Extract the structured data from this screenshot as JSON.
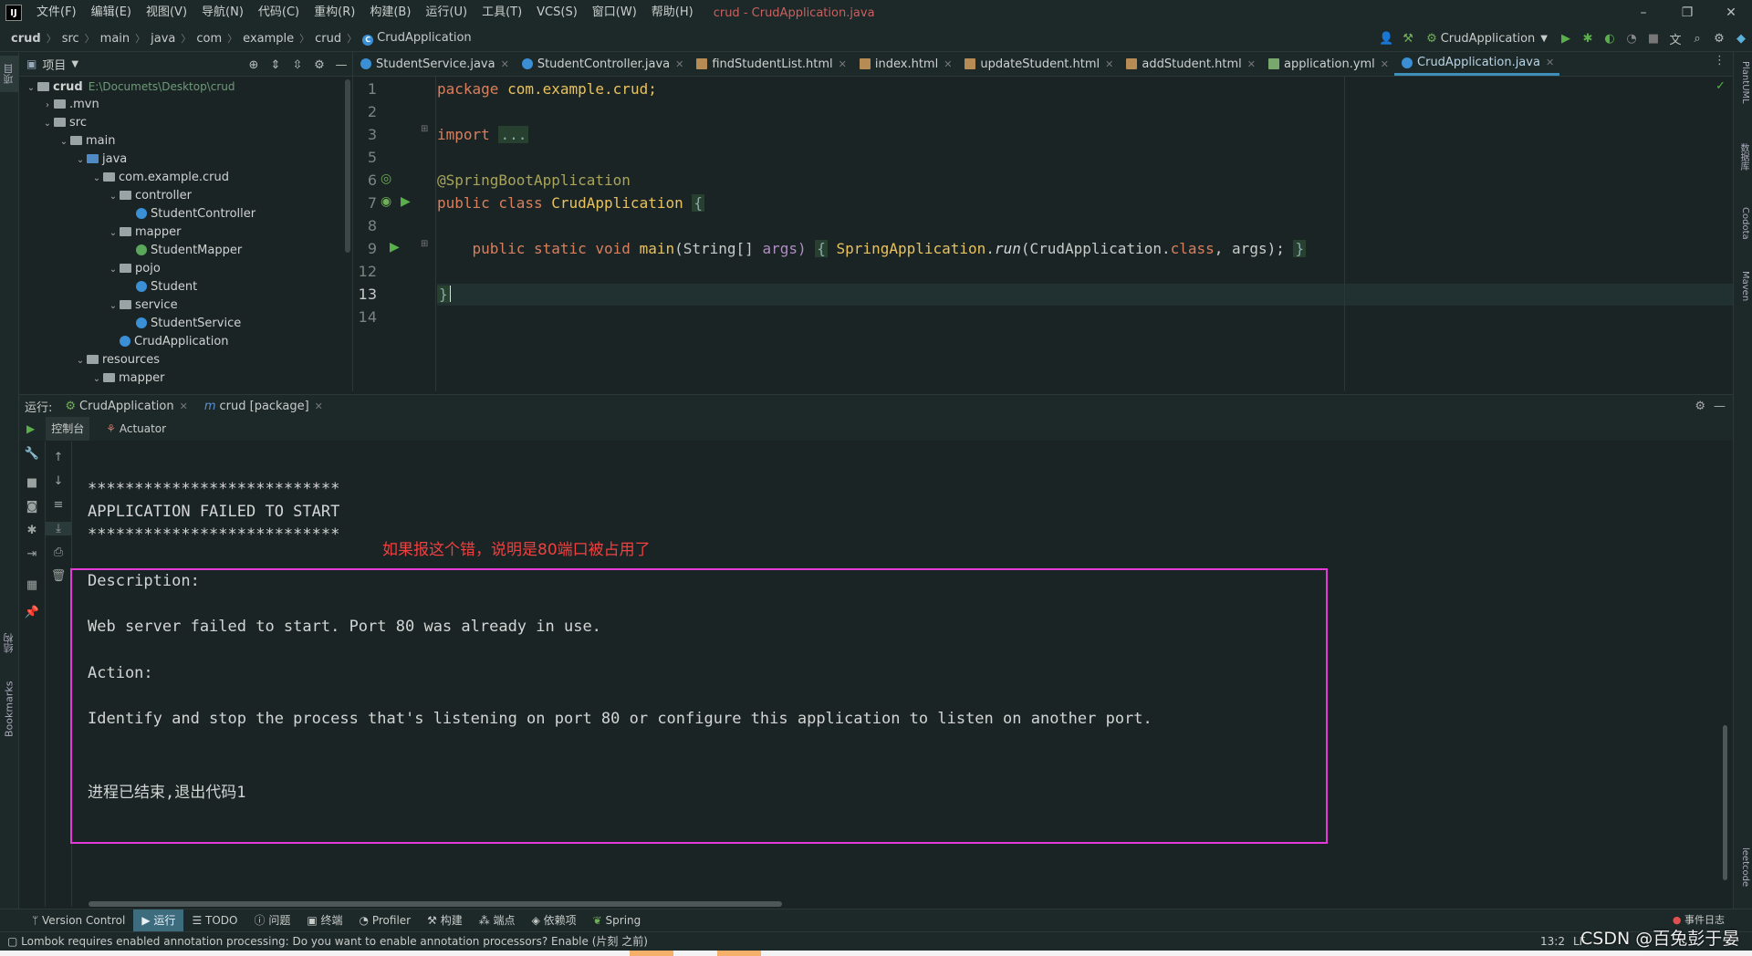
{
  "window": {
    "title": "crud - CrudApplication.java",
    "logo": "IJ",
    "menu": [
      "文件(F)",
      "编辑(E)",
      "视图(V)",
      "导航(N)",
      "代码(C)",
      "重构(R)",
      "构建(B)",
      "运行(U)",
      "工具(T)",
      "VCS(S)",
      "窗口(W)",
      "帮助(H)"
    ],
    "controls": {
      "minimize": "–",
      "restore": "❐",
      "close": "✕"
    }
  },
  "breadcrumbs": [
    "crud",
    "src",
    "main",
    "java",
    "com",
    "example",
    "crud",
    "CrudApplication"
  ],
  "toolbar": {
    "run_config": "CrudApplication"
  },
  "left_strip": {
    "project_tab": "项目",
    "structure_tab": "结构",
    "bookmarks_tab": "Bookmarks"
  },
  "right_strip": {
    "plantuml": "PlantUML",
    "database": "数据库",
    "codota": "Codota",
    "maven": "Maven",
    "leetcode": "leetcode"
  },
  "project": {
    "title": "项目",
    "root_path": "E:\\Documets\\Desktop\\crud",
    "tree": [
      {
        "label": "crud",
        "depth": 0,
        "type": "folder",
        "open": true
      },
      {
        "label": ".mvn",
        "depth": 1,
        "type": "folder",
        "open": false
      },
      {
        "label": "src",
        "depth": 1,
        "type": "folder",
        "open": true
      },
      {
        "label": "main",
        "depth": 2,
        "type": "folder",
        "open": true
      },
      {
        "label": "java",
        "depth": 3,
        "type": "folder-blue",
        "open": true
      },
      {
        "label": "com.example.crud",
        "depth": 4,
        "type": "folder",
        "open": true
      },
      {
        "label": "controller",
        "depth": 5,
        "type": "folder",
        "open": true
      },
      {
        "label": "StudentController",
        "depth": 6,
        "type": "class"
      },
      {
        "label": "mapper",
        "depth": 5,
        "type": "folder",
        "open": true
      },
      {
        "label": "StudentMapper",
        "depth": 6,
        "type": "interface"
      },
      {
        "label": "pojo",
        "depth": 5,
        "type": "folder",
        "open": true
      },
      {
        "label": "Student",
        "depth": 6,
        "type": "class"
      },
      {
        "label": "service",
        "depth": 5,
        "type": "folder",
        "open": true
      },
      {
        "label": "StudentService",
        "depth": 6,
        "type": "class"
      },
      {
        "label": "CrudApplication",
        "depth": 5,
        "type": "class"
      },
      {
        "label": "resources",
        "depth": 3,
        "type": "folder",
        "open": true
      },
      {
        "label": "mapper",
        "depth": 4,
        "type": "folder",
        "open": true
      }
    ]
  },
  "editor_tabs": [
    {
      "label": "StudentService.java",
      "kind": "java"
    },
    {
      "label": "StudentController.java",
      "kind": "java"
    },
    {
      "label": "findStudentList.html",
      "kind": "html"
    },
    {
      "label": "index.html",
      "kind": "html"
    },
    {
      "label": "updateStudent.html",
      "kind": "html"
    },
    {
      "label": "addStudent.html",
      "kind": "html"
    },
    {
      "label": "application.yml",
      "kind": "yml"
    },
    {
      "label": "CrudApplication.java",
      "kind": "java",
      "active": true
    }
  ],
  "code": {
    "line_numbers": [
      "1",
      "2",
      "3",
      "5",
      "6",
      "7",
      "8",
      "9",
      "12",
      "13",
      "14"
    ],
    "package_kw": "package",
    "package_name": "com.example.crud;",
    "import_kw": "import",
    "import_fold": "...",
    "annotation": "@SpringBootApplication",
    "class_decl_kw": "public class",
    "class_name": "CrudApplication",
    "brace_open": "{",
    "main_kw": "public static void",
    "main_name": "main",
    "main_params_type": "(String[]",
    "main_params_name": "args)",
    "main_body_open": "{",
    "main_call_class": "SpringApplication",
    "main_call_method": "run",
    "main_call_args_a": "(CrudApplication.",
    "main_call_args_kw": "class",
    "main_call_args_b": ", args);",
    "main_body_close": "}",
    "brace_close": "}"
  },
  "run_panel": {
    "label": "运行:",
    "tabs": [
      "CrudApplication",
      "crud [package]"
    ],
    "subtabs": [
      "控制台",
      "Actuator"
    ],
    "console": {
      "stars": "***************************",
      "failed": "APPLICATION FAILED TO START",
      "description_label": "Description:",
      "description": "Web server failed to start. Port 80 was already in use.",
      "action_label": "Action:",
      "action": "Identify and stop the process that's listening on port 80 or configure this application to listen on another port.",
      "exit_message": "进程已结束,退出代码1"
    },
    "annotation": "如果报这个错，说明是80端口被占用了"
  },
  "tool_tabs": [
    "Version Control",
    "运行",
    "TODO",
    "问题",
    "终端",
    "Profiler",
    "构建",
    "端点",
    "依赖项",
    "Spring"
  ],
  "event_log": "事件日志",
  "status": {
    "message": "Lombok requires enabled annotation processing: Do you want to enable annotation processors? Enable (片刻 之前)",
    "position": "13:2",
    "encoding": "LF"
  },
  "watermark": "CSDN @百兔彭于晏",
  "colors": {
    "annotation_red": "#f23f3f",
    "highlight_magenta": "#e33ad9",
    "keyword": "#d97f5e",
    "class_name": "#e8c25f"
  }
}
